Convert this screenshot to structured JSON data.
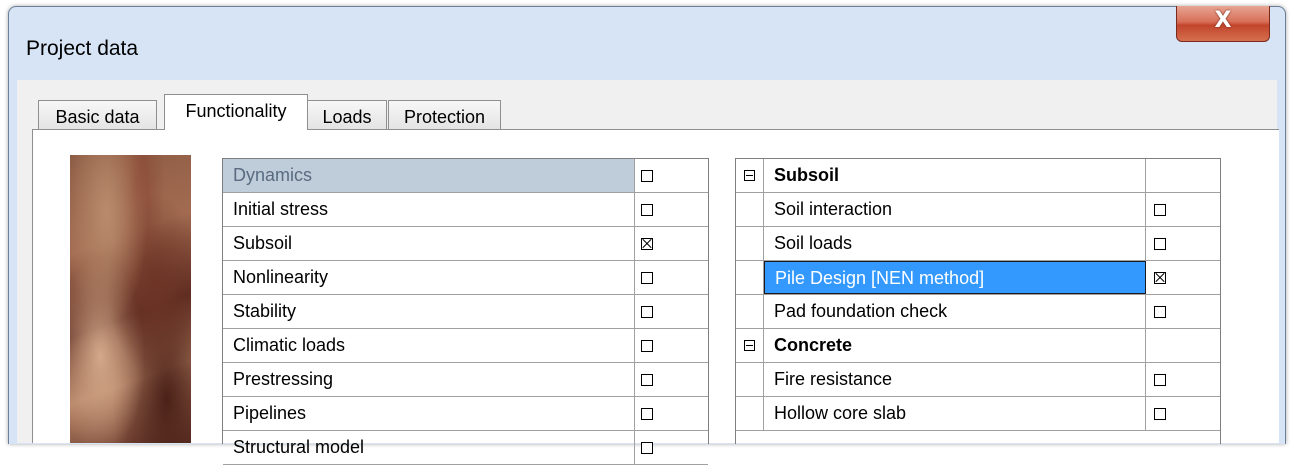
{
  "window": {
    "title": "Project data",
    "close_label": "X"
  },
  "tabs": [
    {
      "label": "Basic data",
      "active": false
    },
    {
      "label": "Functionality",
      "active": true
    },
    {
      "label": "Loads",
      "active": false
    },
    {
      "label": "Protection",
      "active": false
    }
  ],
  "functionality_list": [
    {
      "label": "Dynamics",
      "checked": false,
      "selected": "inactive"
    },
    {
      "label": "Initial stress",
      "checked": false
    },
    {
      "label": "Subsoil",
      "checked": true
    },
    {
      "label": "Nonlinearity",
      "checked": false
    },
    {
      "label": "Stability",
      "checked": false
    },
    {
      "label": "Climatic loads",
      "checked": false
    },
    {
      "label": "Prestressing",
      "checked": false
    },
    {
      "label": "Pipelines",
      "checked": false
    },
    {
      "label": "Structural model",
      "checked": false
    }
  ],
  "detail_tree": {
    "groups": [
      {
        "label": "Subsoil",
        "expanded": true,
        "items": [
          {
            "label": "Soil interaction",
            "checked": false
          },
          {
            "label": "Soil loads",
            "checked": false
          },
          {
            "label": "Pile Design [NEN method]",
            "checked": true,
            "selected": "active"
          },
          {
            "label": "Pad foundation check",
            "checked": false
          }
        ]
      },
      {
        "label": "Concrete",
        "expanded": true,
        "items": [
          {
            "label": "Fire resistance",
            "checked": false
          },
          {
            "label": "Hollow core slab",
            "checked": false
          }
        ]
      }
    ]
  }
}
